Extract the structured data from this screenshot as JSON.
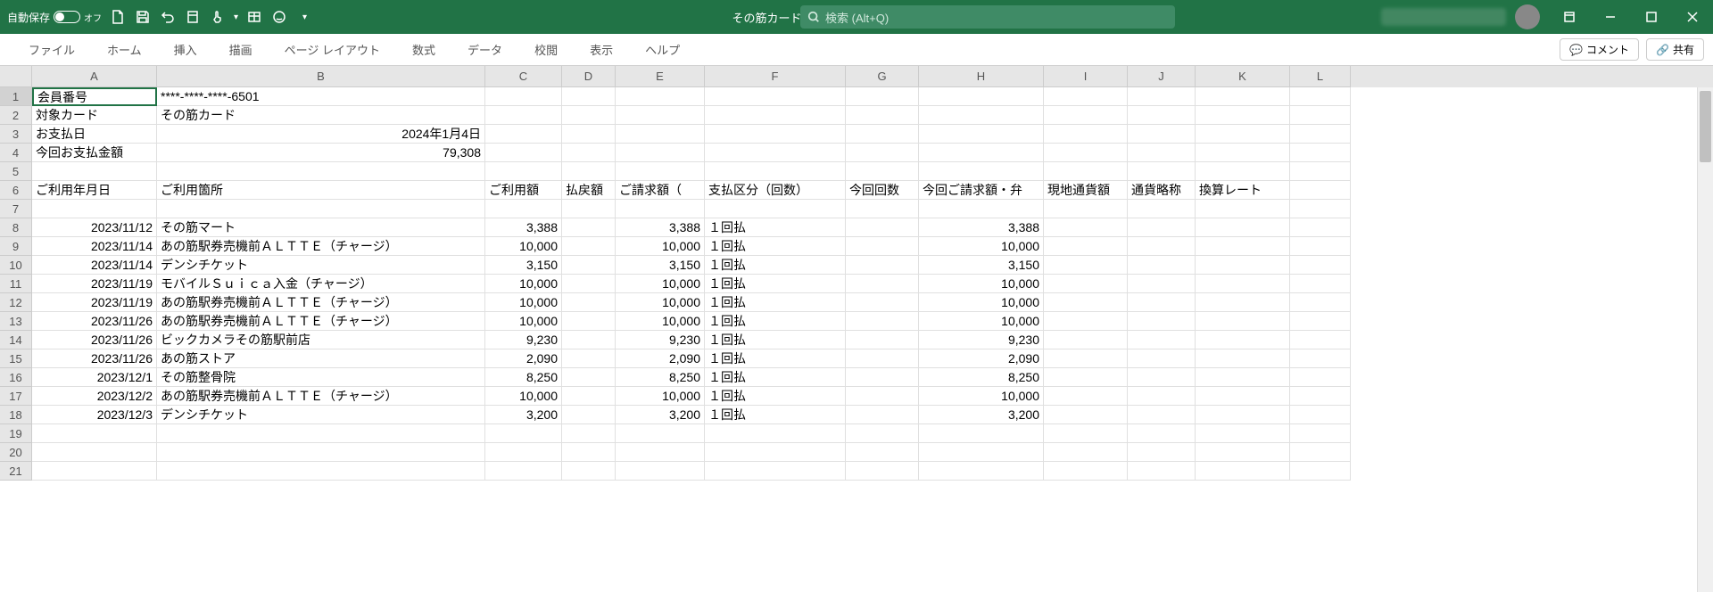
{
  "titlebar": {
    "autosave_label": "自動保存",
    "autosave_state": "オフ",
    "filename": "その筋カード明細.csv",
    "search_placeholder": "検索 (Alt+Q)"
  },
  "ribbon": {
    "tabs": [
      "ファイル",
      "ホーム",
      "挿入",
      "描画",
      "ページ レイアウト",
      "数式",
      "データ",
      "校閲",
      "表示",
      "ヘルプ"
    ],
    "comment_btn": "コメント",
    "share_btn": "共有"
  },
  "columns": [
    "A",
    "B",
    "C",
    "D",
    "E",
    "F",
    "G",
    "H",
    "I",
    "J",
    "K",
    "L"
  ],
  "row_numbers": [
    1,
    2,
    3,
    4,
    5,
    6,
    7,
    8,
    9,
    10,
    11,
    12,
    13,
    14,
    15,
    16,
    17,
    18,
    19,
    20,
    21
  ],
  "meta": {
    "r1a": "会員番号",
    "r1b": "****-****-****-6501",
    "r2a": "対象カード",
    "r2b": "その筋カード",
    "r3a": "お支払日",
    "r3b": "2024年1月4日",
    "r4a": "今回お支払金額",
    "r4b": "79,308"
  },
  "headers": {
    "c6a": "ご利用年月日",
    "c6b": "ご利用箇所",
    "c6c": "ご利用額",
    "c6d": "払戻額",
    "c6e": "ご請求額（",
    "c6f": "支払区分（回数）",
    "c6g": "今回回数",
    "c6h": "今回ご請求額・弁",
    "c6i": "現地通貨額",
    "c6j": "通貨略称",
    "c6k": "換算レート"
  },
  "chart_data": {
    "type": "table",
    "columns": [
      "ご利用年月日",
      "ご利用箇所",
      "ご利用額",
      "払戻額",
      "ご請求額",
      "支払区分（回数）",
      "今回回数",
      "今回ご請求額",
      "現地通貨額",
      "通貨略称",
      "換算レート"
    ],
    "rows": [
      {
        "date": "2023/11/12",
        "place": "その筋マート",
        "amount": "3,388",
        "refund": "",
        "billed": "3,388",
        "ptype": "１回払",
        "times": "",
        "current": "3,388"
      },
      {
        "date": "2023/11/14",
        "place": "あの筋駅券売機前ＡＬＴＴＥ（チャージ）",
        "amount": "10,000",
        "refund": "",
        "billed": "10,000",
        "ptype": "１回払",
        "times": "",
        "current": "10,000"
      },
      {
        "date": "2023/11/14",
        "place": "デンシチケット",
        "amount": "3,150",
        "refund": "",
        "billed": "3,150",
        "ptype": "１回払",
        "times": "",
        "current": "3,150"
      },
      {
        "date": "2023/11/19",
        "place": "モバイルＳｕｉｃａ入金（チャージ）",
        "amount": "10,000",
        "refund": "",
        "billed": "10,000",
        "ptype": "１回払",
        "times": "",
        "current": "10,000"
      },
      {
        "date": "2023/11/19",
        "place": "あの筋駅券売機前ＡＬＴＴＥ（チャージ）",
        "amount": "10,000",
        "refund": "",
        "billed": "10,000",
        "ptype": "１回払",
        "times": "",
        "current": "10,000"
      },
      {
        "date": "2023/11/26",
        "place": "あの筋駅券売機前ＡＬＴＴＥ（チャージ）",
        "amount": "10,000",
        "refund": "",
        "billed": "10,000",
        "ptype": "１回払",
        "times": "",
        "current": "10,000"
      },
      {
        "date": "2023/11/26",
        "place": "ビックカメラその筋駅前店",
        "amount": "9,230",
        "refund": "",
        "billed": "9,230",
        "ptype": "１回払",
        "times": "",
        "current": "9,230"
      },
      {
        "date": "2023/11/26",
        "place": "あの筋ストア",
        "amount": "2,090",
        "refund": "",
        "billed": "2,090",
        "ptype": "１回払",
        "times": "",
        "current": "2,090"
      },
      {
        "date": "2023/12/1",
        "place": "その筋整骨院",
        "amount": "8,250",
        "refund": "",
        "billed": "8,250",
        "ptype": "１回払",
        "times": "",
        "current": "8,250"
      },
      {
        "date": "2023/12/2",
        "place": "あの筋駅券売機前ＡＬＴＴＥ（チャージ）",
        "amount": "10,000",
        "refund": "",
        "billed": "10,000",
        "ptype": "１回払",
        "times": "",
        "current": "10,000"
      },
      {
        "date": "2023/12/3",
        "place": "デンシチケット",
        "amount": "3,200",
        "refund": "",
        "billed": "3,200",
        "ptype": "１回払",
        "times": "",
        "current": "3,200"
      }
    ]
  }
}
